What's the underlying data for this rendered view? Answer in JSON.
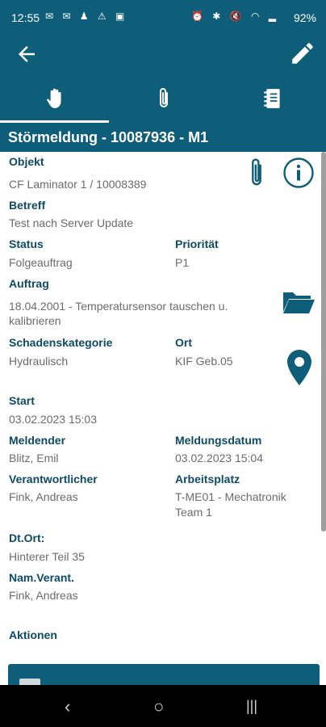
{
  "status_bar": {
    "time": "12:55",
    "battery": "92%",
    "left_icons": [
      "mail-icon",
      "mail-icon",
      "notification-icon",
      "warning-icon",
      "image-icon"
    ],
    "right_icons": [
      "alarm-icon",
      "bluetooth-icon",
      "mute-icon",
      "wifi-icon",
      "signal-icon"
    ]
  },
  "header": {
    "tabs": [
      {
        "name": "tab-hand",
        "icon": "hand-icon",
        "active": true
      },
      {
        "name": "tab-attachments",
        "icon": "paperclip-icon",
        "active": false
      },
      {
        "name": "tab-notes",
        "icon": "notebook-icon",
        "active": false
      }
    ],
    "title_main": "Störmeldung",
    "title_rest": " - 10087936 - M1"
  },
  "fields": {
    "objekt": {
      "label": "Objekt",
      "value": "CF Laminator 1 / 10008389"
    },
    "betreff": {
      "label": "Betreff",
      "value": "Test nach Server Update"
    },
    "status": {
      "label": "Status",
      "value": "Folgeauftrag"
    },
    "prioritaet": {
      "label": "Priorität",
      "value": "P1"
    },
    "auftrag": {
      "label": "Auftrag",
      "value_line1": "18.04.2001 - Temperatursensor tauschen u.",
      "value_line2": "kalibrieren"
    },
    "schadenskategorie": {
      "label": "Schadenskategorie",
      "value": "Hydraulisch"
    },
    "ort": {
      "label": "Ort",
      "value": "KIF Geb.05"
    },
    "start": {
      "label": "Start",
      "value": "03.02.2023 15:03"
    },
    "meldender": {
      "label": "Meldender",
      "value": "Blitz, Emil"
    },
    "meldungsdatum": {
      "label": "Meldungsdatum",
      "value": "03.02.2023 15:04"
    },
    "verantwortlicher": {
      "label": "Verantwortlicher",
      "value": "Fink, Andreas"
    },
    "arbeitsplatz": {
      "label": "Arbeitsplatz",
      "value_line1": "T-ME01 - Mechatronik",
      "value_line2": "Team 1"
    },
    "dt_ort": {
      "label": "Dt.Ort:",
      "value": "Hinterer Teil 35"
    },
    "nam_verant": {
      "label": "Nam.Verant.",
      "value": "Fink, Andreas"
    }
  },
  "actions": {
    "label": "Aktionen"
  },
  "colors": {
    "primary": "#0e5d79",
    "label": "#0d4a63",
    "value": "#6b6b6b"
  },
  "nav": {
    "back": "‹",
    "home": "○",
    "recents": "|||"
  }
}
